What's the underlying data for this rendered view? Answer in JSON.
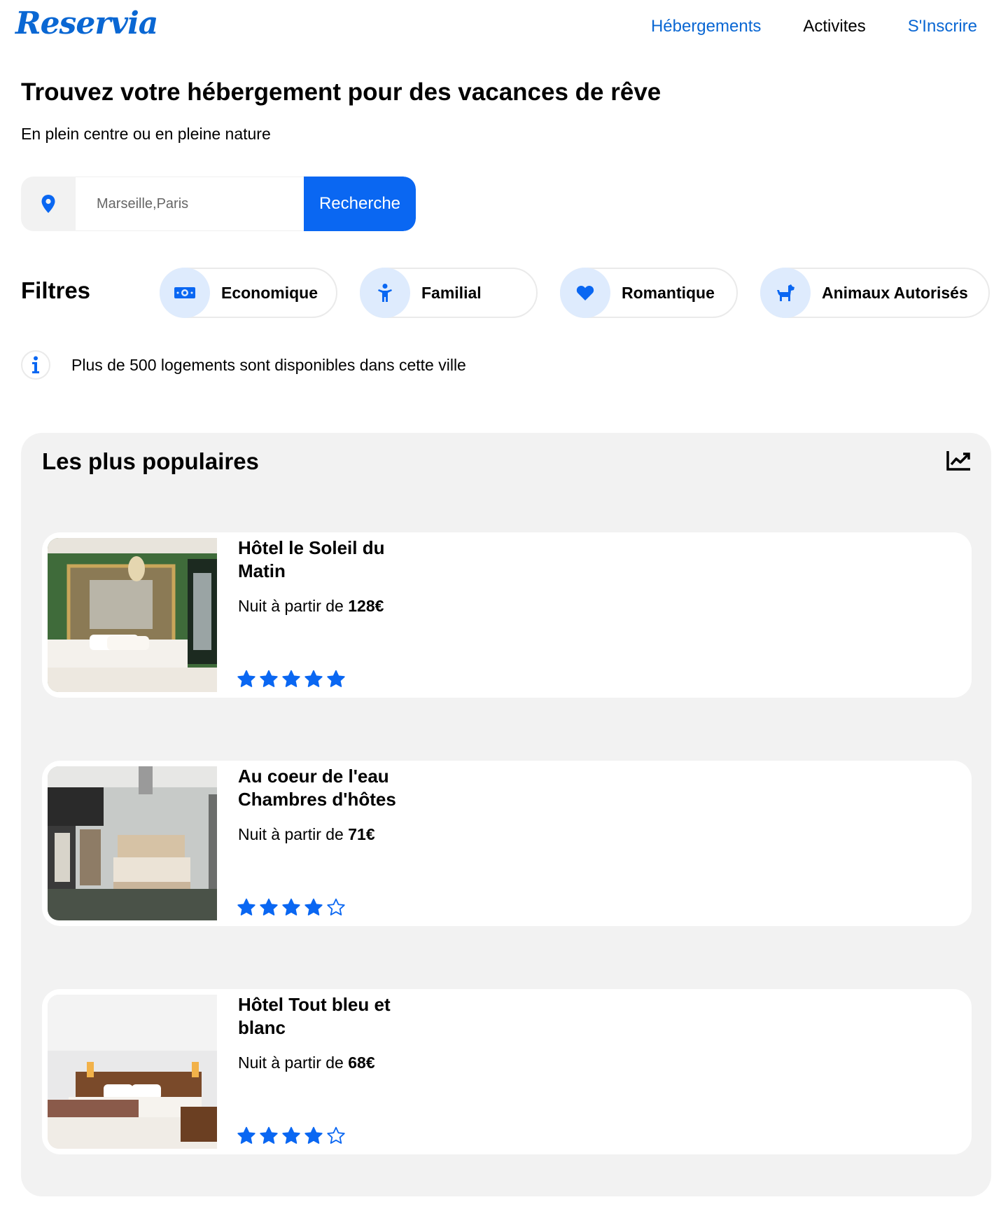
{
  "header": {
    "logo": "Reservia",
    "nav": [
      {
        "label": "Hébergements"
      },
      {
        "label": "Activites"
      },
      {
        "label": "S'Inscrire"
      }
    ]
  },
  "hero": {
    "title": "Trouvez votre hébergement pour des vacances de rêve",
    "subtitle": "En plein centre ou en pleine nature"
  },
  "search": {
    "placeholder": "Marseille,Paris",
    "value": "",
    "button": "Recherche",
    "icon": "location-pin-icon"
  },
  "filters": {
    "title": "Filtres",
    "items": [
      {
        "label": "Economique",
        "icon": "money-icon"
      },
      {
        "label": "Familial",
        "icon": "child-icon"
      },
      {
        "label": "Romantique",
        "icon": "heart-icon"
      },
      {
        "label": "Animaux Autorisés",
        "icon": "dog-icon"
      }
    ]
  },
  "info": {
    "text": "Plus de 500 logements sont disponibles dans cette ville",
    "icon": "info-icon"
  },
  "popular": {
    "title": "Les plus populaires",
    "icon": "trend-chart-icon",
    "price_prefix": "Nuit à partir de ",
    "hotels": [
      {
        "name": "Hôtel le Soleil du Matin",
        "price": "128€",
        "rating": 5
      },
      {
        "name": "Au coeur de l'eau Chambres d'hôtes",
        "price": "71€",
        "rating": 4
      },
      {
        "name": "Hôtel Tout bleu et blanc",
        "price": "68€",
        "rating": 4
      }
    ]
  },
  "colors": {
    "accent": "#0a67f2",
    "chip_bg": "#deebfd",
    "section_bg": "#f2f2f2"
  }
}
